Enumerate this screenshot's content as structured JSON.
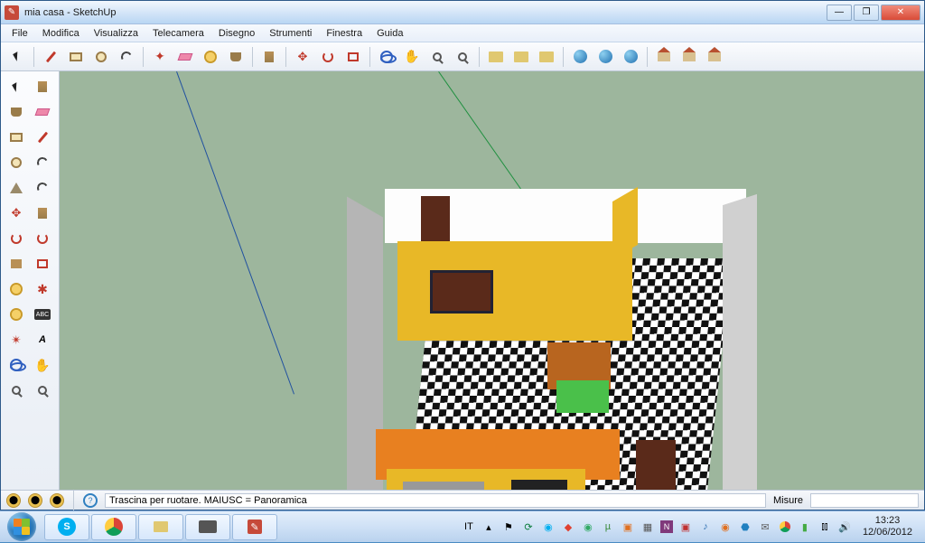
{
  "titlebar": {
    "title": "mia casa - SketchUp"
  },
  "menu": [
    "File",
    "Modifica",
    "Visualizza",
    "Telecamera",
    "Disegno",
    "Strumenti",
    "Finestra",
    "Guida"
  ],
  "status": {
    "hint": "Trascina per ruotare.  MAIUSC = Panoramica",
    "measure_label": "Misure"
  },
  "tray": {
    "lang": "IT",
    "time": "13:23",
    "date": "12/06/2012"
  },
  "text_label": "ABC"
}
